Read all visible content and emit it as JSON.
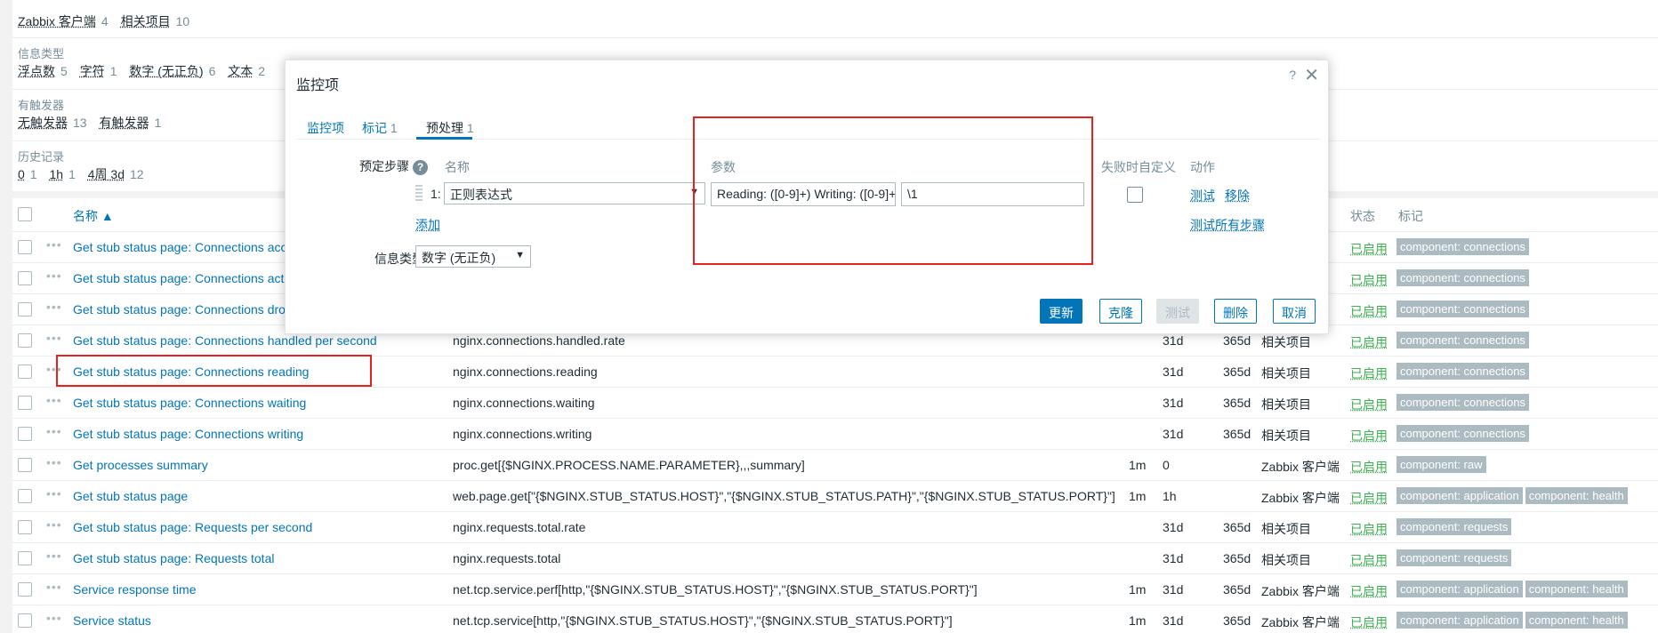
{
  "filter": {
    "row0": {
      "items": [
        {
          "label": "Zabbix 客户端",
          "count": "4"
        },
        {
          "label": "相关项目",
          "count": "10"
        }
      ]
    },
    "info_type": {
      "label": "信息类型",
      "items": [
        {
          "label": "浮点数",
          "count": "5"
        },
        {
          "label": "字符",
          "count": "1"
        },
        {
          "label": "数字 (无正负)",
          "count": "6"
        },
        {
          "label": "文本",
          "count": "2"
        }
      ]
    },
    "triggers": {
      "label": "有触发器",
      "items": [
        {
          "label": "无触发器",
          "count": "13"
        },
        {
          "label": "有触发器",
          "count": "1"
        }
      ]
    },
    "history": {
      "label": "历史记录",
      "items": [
        {
          "label": "0",
          "count": "1"
        },
        {
          "label": "1h",
          "count": "1"
        },
        {
          "label": "4周 3d",
          "count": "12"
        }
      ]
    }
  },
  "table": {
    "headers": {
      "name": "名称 ▲",
      "status": "状态",
      "tags": "标记"
    },
    "rows": [
      {
        "name": "Get stub status page: Connections acce",
        "key": "",
        "interval": "",
        "history": "",
        "trends": "",
        "type": "",
        "status": "已启用",
        "tags": [
          "component: connections"
        ]
      },
      {
        "name": "Get stub status page: Connections activ",
        "key": "",
        "interval": "",
        "history": "",
        "trends": "",
        "type": "",
        "status": "已启用",
        "tags": [
          "component: connections"
        ]
      },
      {
        "name": "Get stub status page: Connections drop",
        "key": "",
        "interval": "",
        "history": "",
        "trends": "",
        "type": "",
        "status": "已启用",
        "tags": [
          "component: connections"
        ]
      },
      {
        "name": "Get stub status page: Connections handled per second",
        "key": "nginx.connections.handled.rate",
        "interval": "",
        "history": "31d",
        "trends": "365d",
        "type": "相关项目",
        "status": "已启用",
        "tags": [
          "component: connections"
        ]
      },
      {
        "name": "Get stub status page: Connections reading",
        "key": "nginx.connections.reading",
        "interval": "",
        "history": "31d",
        "trends": "365d",
        "type": "相关项目",
        "status": "已启用",
        "tags": [
          "component: connections"
        ]
      },
      {
        "name": "Get stub status page: Connections waiting",
        "key": "nginx.connections.waiting",
        "interval": "",
        "history": "31d",
        "trends": "365d",
        "type": "相关项目",
        "status": "已启用",
        "tags": [
          "component: connections"
        ]
      },
      {
        "name": "Get stub status page: Connections writing",
        "key": "nginx.connections.writing",
        "interval": "",
        "history": "31d",
        "trends": "365d",
        "type": "相关项目",
        "status": "已启用",
        "tags": [
          "component: connections"
        ]
      },
      {
        "name": "Get processes summary",
        "key": "proc.get[{$NGINX.PROCESS.NAME.PARAMETER},,,summary]",
        "interval": "1m",
        "history": "0",
        "trends": "",
        "type": "Zabbix 客户端",
        "status": "已启用",
        "tags": [
          "component: raw"
        ]
      },
      {
        "name": "Get stub status page",
        "key": "web.page.get[\"{$NGINX.STUB_STATUS.HOST}\",\"{$NGINX.STUB_STATUS.PATH}\",\"{$NGINX.STUB_STATUS.PORT}\"]",
        "interval": "1m",
        "history": "1h",
        "trends": "",
        "type": "Zabbix 客户端",
        "status": "已启用",
        "tags": [
          "component: application",
          "component: health"
        ]
      },
      {
        "name": "Get stub status page: Requests per second",
        "key": "nginx.requests.total.rate",
        "interval": "",
        "history": "31d",
        "trends": "365d",
        "type": "相关项目",
        "status": "已启用",
        "tags": [
          "component: requests"
        ]
      },
      {
        "name": "Get stub status page: Requests total",
        "key": "nginx.requests.total",
        "interval": "",
        "history": "31d",
        "trends": "365d",
        "type": "相关项目",
        "status": "已启用",
        "tags": [
          "component: requests"
        ]
      },
      {
        "name": "Service response time",
        "key": "net.tcp.service.perf[http,\"{$NGINX.STUB_STATUS.HOST}\",\"{$NGINX.STUB_STATUS.PORT}\"]",
        "interval": "1m",
        "history": "31d",
        "trends": "365d",
        "type": "Zabbix 客户端",
        "status": "已启用",
        "tags": [
          "component: application",
          "component: health"
        ]
      },
      {
        "name": "Service status",
        "key": "net.tcp.service[http,\"{$NGINX.STUB_STATUS.HOST}\",\"{$NGINX.STUB_STATUS.PORT}\"]",
        "interval": "1m",
        "history": "31d",
        "trends": "365d",
        "type": "Zabbix 客户端",
        "status": "已启用",
        "tags": [
          "component: application",
          "component: health"
        ]
      }
    ]
  },
  "dialog": {
    "title": "监控项",
    "help": "?",
    "close": "✕",
    "tabs": [
      {
        "label": "监控项",
        "count": ""
      },
      {
        "label": "标记",
        "count": "1"
      },
      {
        "label": "预处理",
        "count": "1"
      }
    ],
    "preprocessing": {
      "label": "预定步骤",
      "help_icon": "?",
      "col_name": "名称",
      "col_params": "参数",
      "col_custom_on_fail": "失败时自定义",
      "col_actions": "动作",
      "step_number": "1:",
      "step_type": "正则表达式",
      "param1": "Reading: ([0-9]+) Writing: ([0-9]+",
      "param2": "\\1",
      "test_link": "测试",
      "remove_link": "移除",
      "add_link": "添加",
      "test_all_link": "测试所有步骤"
    },
    "info_type": {
      "label": "信息类型",
      "value": "数字 (无正负)"
    },
    "buttons": {
      "update": "更新",
      "clone": "克隆",
      "test": "测试",
      "delete": "删除",
      "cancel": "取消"
    }
  }
}
